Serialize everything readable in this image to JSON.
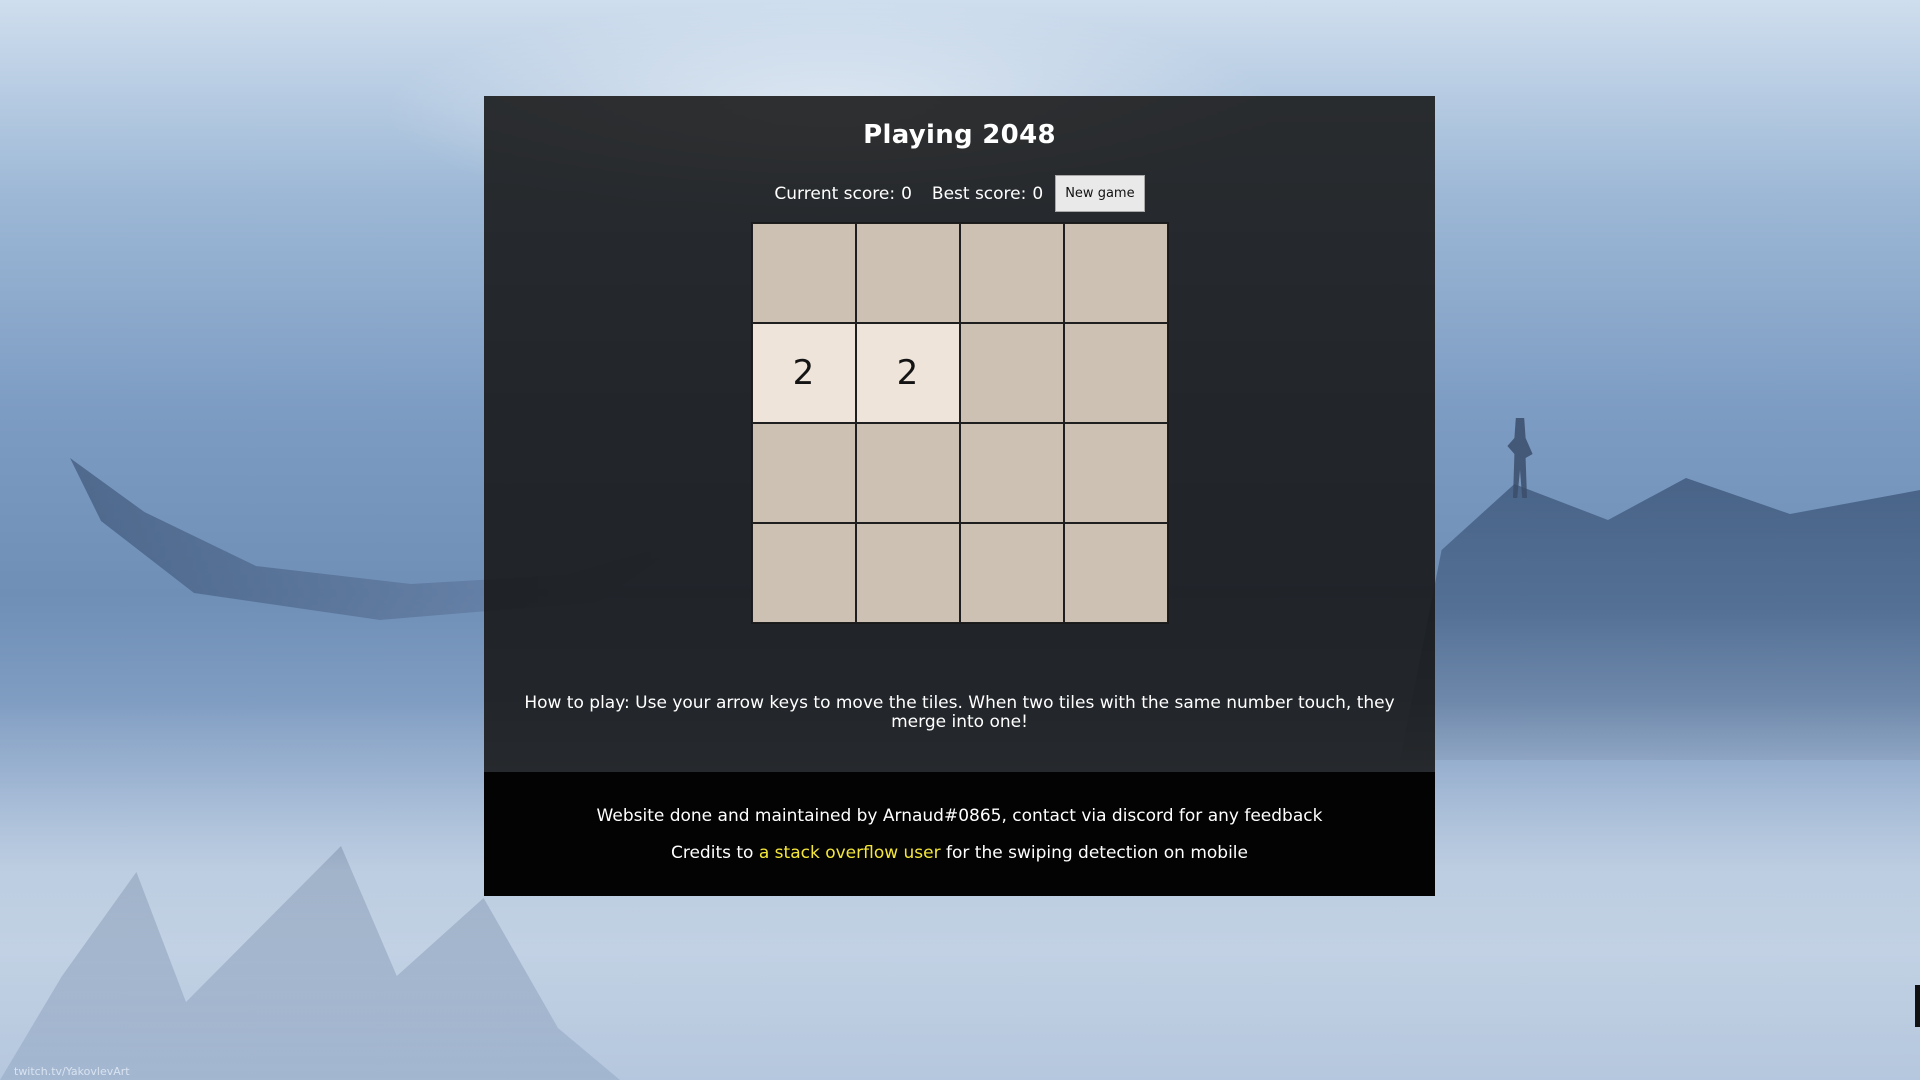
{
  "page": {
    "title": "Playing 2048",
    "watermark": "twitch.tv/YakovlevArt"
  },
  "scores": {
    "current_label": "Current score:",
    "current_value": "0",
    "best_label": "Best score:",
    "best_value": "0",
    "new_game_label": "New game"
  },
  "board": {
    "size": 4,
    "rows": [
      [
        "",
        "",
        "",
        ""
      ],
      [
        "2",
        "2",
        "",
        ""
      ],
      [
        "",
        "",
        "",
        ""
      ],
      [
        "",
        "",
        "",
        ""
      ]
    ],
    "colors": {
      "empty": "#cdc1b3",
      "tile_2": "#eee4da"
    }
  },
  "instructions": {
    "text": "How to play: Use your arrow keys to move the tiles. When two tiles with the same number touch, they merge into one!"
  },
  "footer": {
    "maintainer_text": "Website done and maintained by Arnaud#0865, contact via discord for any feedback",
    "credits_prefix": "Credits to ",
    "credits_link": "a stack overflow user",
    "credits_suffix": " for the swiping detection on mobile",
    "link_color": "#f5e63a"
  }
}
